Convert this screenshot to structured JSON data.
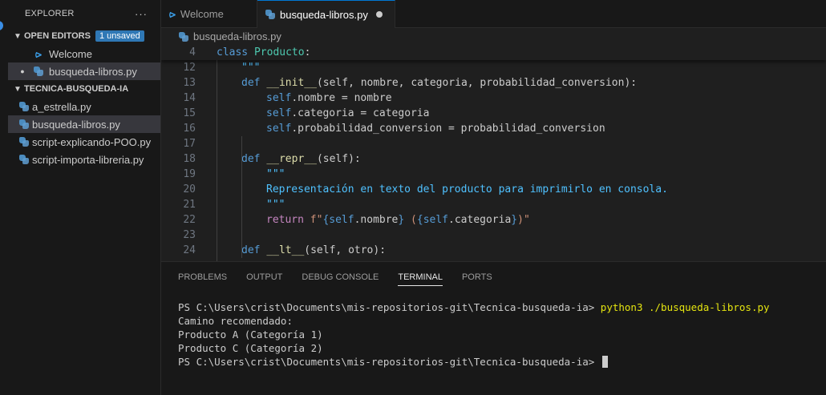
{
  "sidebar": {
    "title": "EXPLORER",
    "more": "···",
    "open_editors": {
      "label": "OPEN EDITORS",
      "badge": "1 unsaved",
      "items": [
        {
          "label": "Welcome"
        },
        {
          "label": "busqueda-libros.py"
        }
      ]
    },
    "folder": {
      "label": "TECNICA-BUSQUEDA-IA",
      "files": [
        {
          "label": "a_estrella.py"
        },
        {
          "label": "busqueda-libros.py"
        },
        {
          "label": "script-explicando-POO.py"
        },
        {
          "label": "script-importa-libreria.py"
        }
      ]
    }
  },
  "tabs": [
    {
      "label": "Welcome"
    },
    {
      "label": "busqueda-libros.py"
    }
  ],
  "breadcrumb": "busqueda-libros.py",
  "editor": {
    "sticky": {
      "n": "4",
      "kw": "class",
      "name": "Producto",
      "punct": ":"
    },
    "lines": {
      "l12": {
        "n": "12",
        "t": "\"\"\""
      },
      "l13": {
        "n": "13",
        "kw": "def",
        "fn": "__init__",
        "args": "(self, nombre, categoria, probabilidad_conversion):"
      },
      "l14": {
        "n": "14",
        "self": "self",
        "rest": ".nombre = nombre"
      },
      "l15": {
        "n": "15",
        "self": "self",
        "rest": ".categoria = categoria"
      },
      "l16": {
        "n": "16",
        "self": "self",
        "rest": ".probabilidad_conversion = probabilidad_conversion"
      },
      "l17": {
        "n": "17"
      },
      "l18": {
        "n": "18",
        "kw": "def",
        "fn": "__repr__",
        "args": "(self):"
      },
      "l19": {
        "n": "19",
        "t": "\"\"\""
      },
      "l20": {
        "n": "20",
        "t": "Representación en texto del producto para imprimirlo en consola."
      },
      "l21": {
        "n": "21",
        "t": "\"\"\""
      },
      "l22": {
        "n": "22",
        "ret": "return",
        "f": "f\"",
        "b1": "{",
        "self1": "self",
        "a1": ".nombre",
        "b2": "}",
        "s1": " (",
        "b3": "{",
        "self2": "self",
        "a2": ".categoria",
        "b4": "}",
        "s2": ")\""
      },
      "l23": {
        "n": "23"
      },
      "l24": {
        "n": "24",
        "kw": "def",
        "fn": "__lt__",
        "args": "(self, otro):"
      }
    }
  },
  "panel": {
    "tabs": [
      "PROBLEMS",
      "OUTPUT",
      "DEBUG CONSOLE",
      "TERMINAL",
      "PORTS"
    ],
    "terminal": {
      "prompt": "PS C:\\Users\\crist\\Documents\\mis-repositorios-git\\Tecnica-busqueda-ia> ",
      "command": "python3 ./busqueda-libros.py",
      "out1": "Camino recomendado:",
      "out2": "Producto A (Categoría 1)",
      "out3": "Producto C (Categoría 2)",
      "prompt2": "PS C:\\Users\\crist\\Documents\\mis-repositorios-git\\Tecnica-busqueda-ia> "
    }
  }
}
